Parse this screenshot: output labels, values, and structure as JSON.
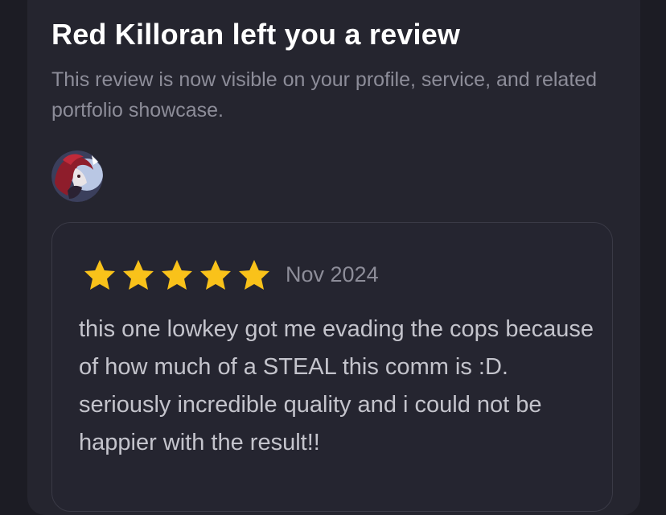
{
  "notification": {
    "title": "Red Killoran left you a review",
    "subtitle": "This review is now visible on your profile, service, and related portfolio showcase."
  },
  "reviewer": {
    "avatar_icon": "reviewer-avatar"
  },
  "review": {
    "rating": 5,
    "rating_max": 5,
    "star_color": "#f9c21a",
    "date": "Nov 2024",
    "text": "this one lowkey got me evading the cops because of how much of a STEAL this comm is :D. seriously incredible quality and i could not be happier with the result!!"
  },
  "colors": {
    "background": "#1c1c24",
    "card": "#25252f",
    "title": "#ffffff",
    "muted": "#8d8d99",
    "body_text": "#c4c4cc"
  }
}
